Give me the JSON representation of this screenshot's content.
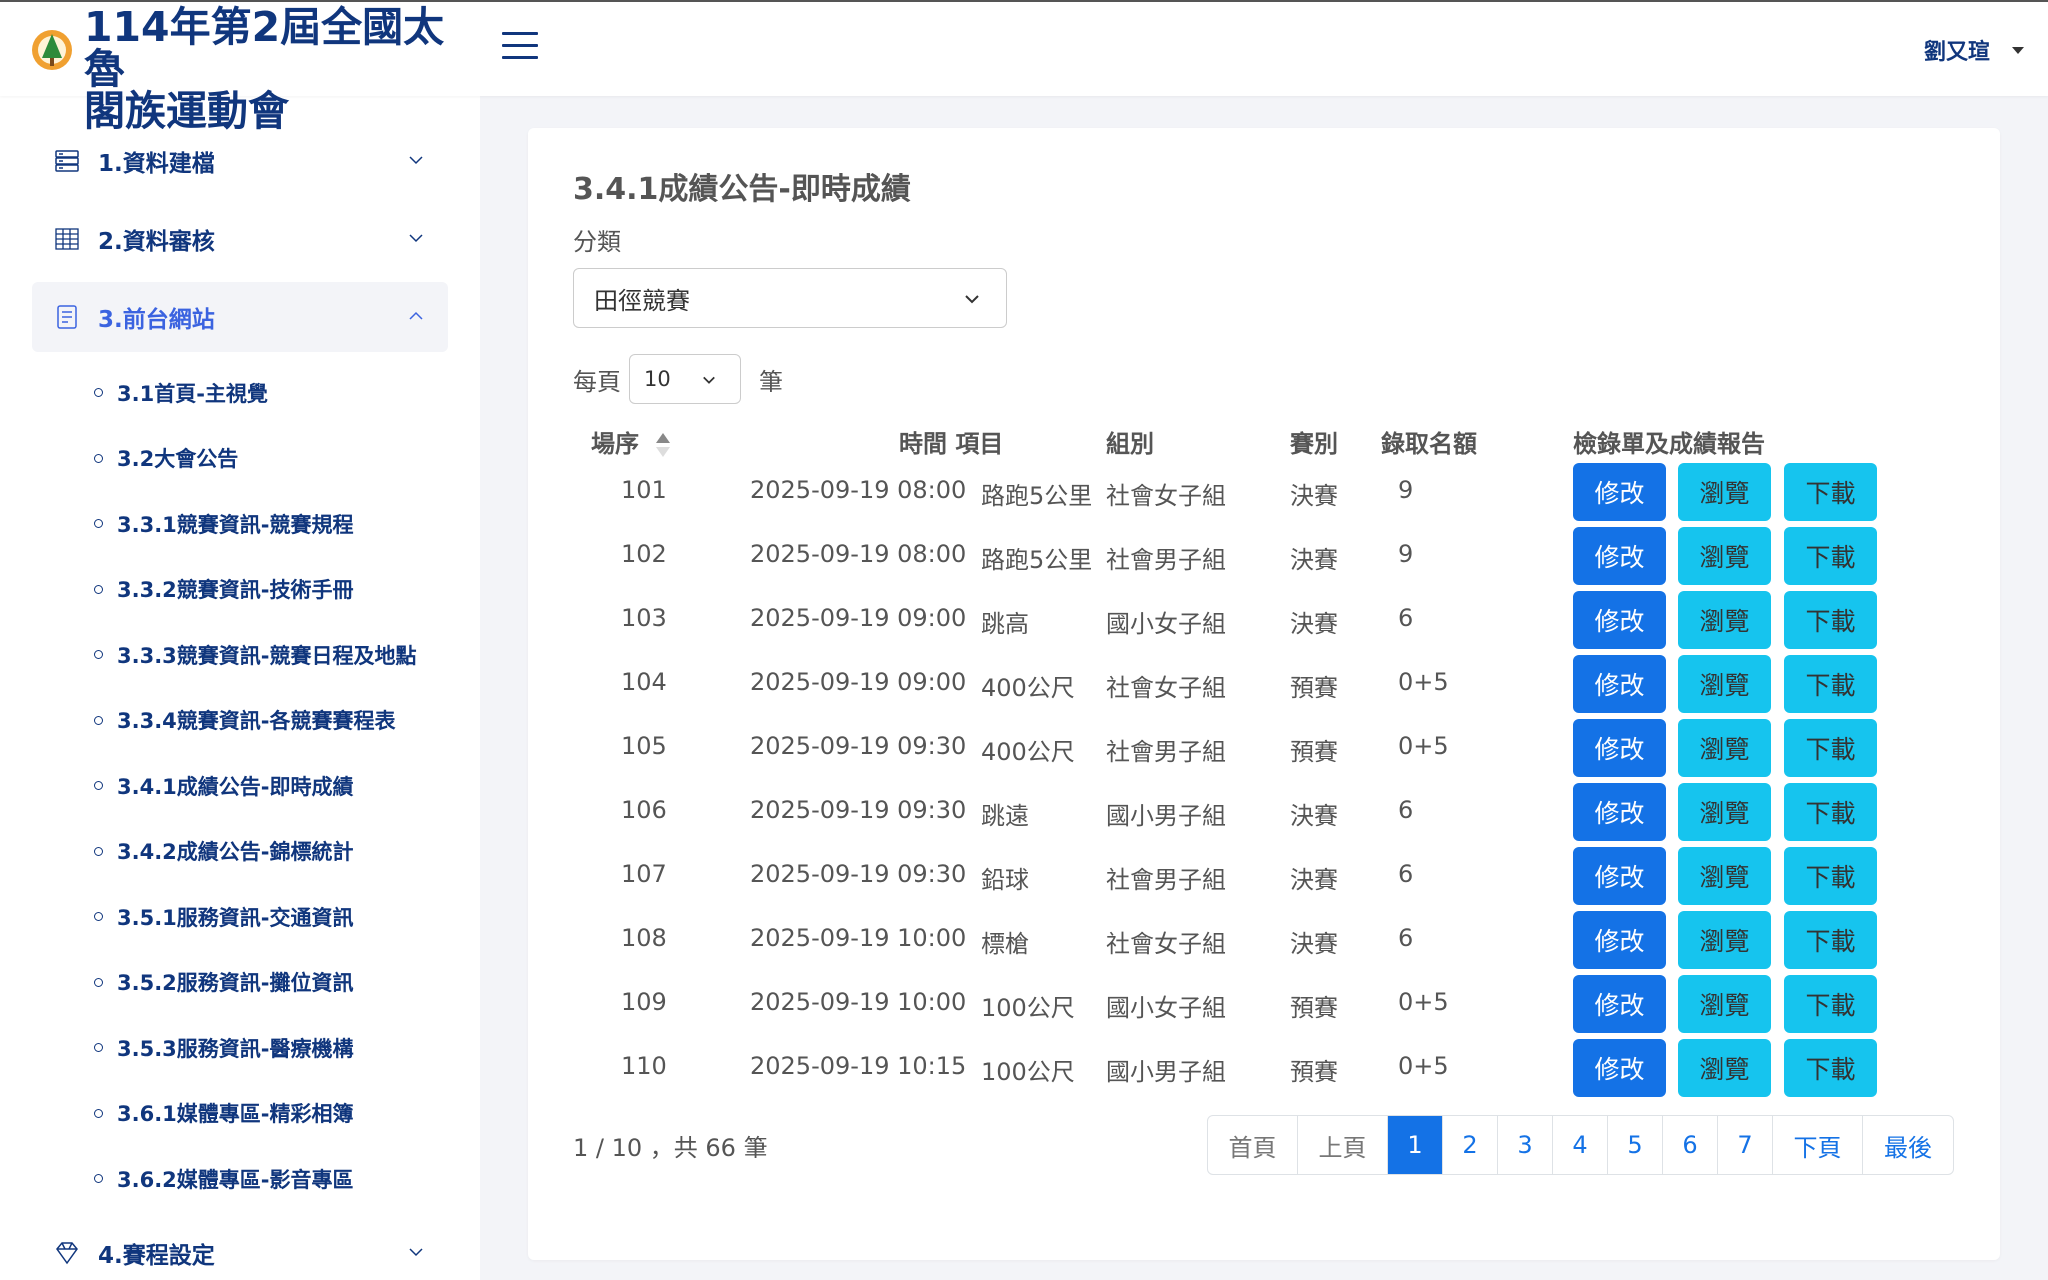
{
  "header": {
    "brand_line1": "114年第2屆全國太魯",
    "brand_line2": "閣族運動會",
    "user": "劉又瑄"
  },
  "sidebar": {
    "items": [
      {
        "label": "1.資料建檔",
        "icon": "server-icon",
        "expanded": false
      },
      {
        "label": "2.資料審核",
        "icon": "database-grid-icon",
        "expanded": false
      },
      {
        "label": "3.前台網站",
        "icon": "document-list-icon",
        "expanded": true
      },
      {
        "label": "4.賽程設定",
        "icon": "diamond-icon",
        "expanded": false
      }
    ],
    "subitems": [
      "3.1首頁-主視覺",
      "3.2大會公告",
      "3.3.1競賽資訊-競賽規程",
      "3.3.2競賽資訊-技術手冊",
      "3.3.3競賽資訊-競賽日程及地點",
      "3.3.4競賽資訊-各競賽賽程表",
      "3.4.1成績公告-即時成績",
      "3.4.2成績公告-錦標統計",
      "3.5.1服務資訊-交通資訊",
      "3.5.2服務資訊-攤位資訊",
      "3.5.3服務資訊-醫療機構",
      "3.6.1媒體專區-精彩相簿",
      "3.6.2媒體專區-影音專區"
    ]
  },
  "main": {
    "title": "3.4.1成績公告-即時成績",
    "filter_label": "分類",
    "filter_value": "田徑競賽",
    "perpage_prefix": "每頁",
    "perpage_value": "10",
    "perpage_suffix": "筆",
    "columns": {
      "order": "場序",
      "time_item": "時間 項目",
      "group": "組別",
      "stage": "賽別",
      "quota": "錄取名額",
      "report": "檢錄單及成績報告"
    },
    "buttons": {
      "edit": "修改",
      "view": "瀏覽",
      "download": "下載"
    },
    "rows": [
      {
        "order": "101",
        "time": "2025-09-19 08:00",
        "item": "路跑5公里",
        "group": "社會女子組",
        "stage": "決賽",
        "quota": "9"
      },
      {
        "order": "102",
        "time": "2025-09-19 08:00",
        "item": "路跑5公里",
        "group": "社會男子組",
        "stage": "決賽",
        "quota": "9"
      },
      {
        "order": "103",
        "time": "2025-09-19 09:00",
        "item": "跳高",
        "group": "國小女子組",
        "stage": "決賽",
        "quota": "6"
      },
      {
        "order": "104",
        "time": "2025-09-19 09:00",
        "item": "400公尺",
        "group": "社會女子組",
        "stage": "預賽",
        "quota": "0+5"
      },
      {
        "order": "105",
        "time": "2025-09-19 09:30",
        "item": "400公尺",
        "group": "社會男子組",
        "stage": "預賽",
        "quota": "0+5"
      },
      {
        "order": "106",
        "time": "2025-09-19 09:30",
        "item": "跳遠",
        "group": "國小男子組",
        "stage": "決賽",
        "quota": "6"
      },
      {
        "order": "107",
        "time": "2025-09-19 09:30",
        "item": "鉛球",
        "group": "社會男子組",
        "stage": "決賽",
        "quota": "6"
      },
      {
        "order": "108",
        "time": "2025-09-19 10:00",
        "item": "標槍",
        "group": "社會女子組",
        "stage": "決賽",
        "quota": "6"
      },
      {
        "order": "109",
        "time": "2025-09-19 10:00",
        "item": "100公尺",
        "group": "國小女子組",
        "stage": "預賽",
        "quota": "0+5"
      },
      {
        "order": "110",
        "time": "2025-09-19 10:15",
        "item": "100公尺",
        "group": "國小男子組",
        "stage": "預賽",
        "quota": "0+5"
      }
    ],
    "summary": "1 / 10 ，共 66 筆",
    "pagination": [
      {
        "label": "首頁",
        "kind": "muted"
      },
      {
        "label": "上頁",
        "kind": "muted"
      },
      {
        "label": "1",
        "kind": "active"
      },
      {
        "label": "2",
        "kind": "link"
      },
      {
        "label": "3",
        "kind": "link"
      },
      {
        "label": "4",
        "kind": "link"
      },
      {
        "label": "5",
        "kind": "link"
      },
      {
        "label": "6",
        "kind": "link"
      },
      {
        "label": "7",
        "kind": "link"
      },
      {
        "label": "下頁",
        "kind": "link"
      },
      {
        "label": "最後",
        "kind": "link"
      }
    ]
  },
  "colors": {
    "brand": "#10367d",
    "active_menu": "#3b63e0",
    "primary": "#1472e6",
    "info": "#16c4ee"
  }
}
